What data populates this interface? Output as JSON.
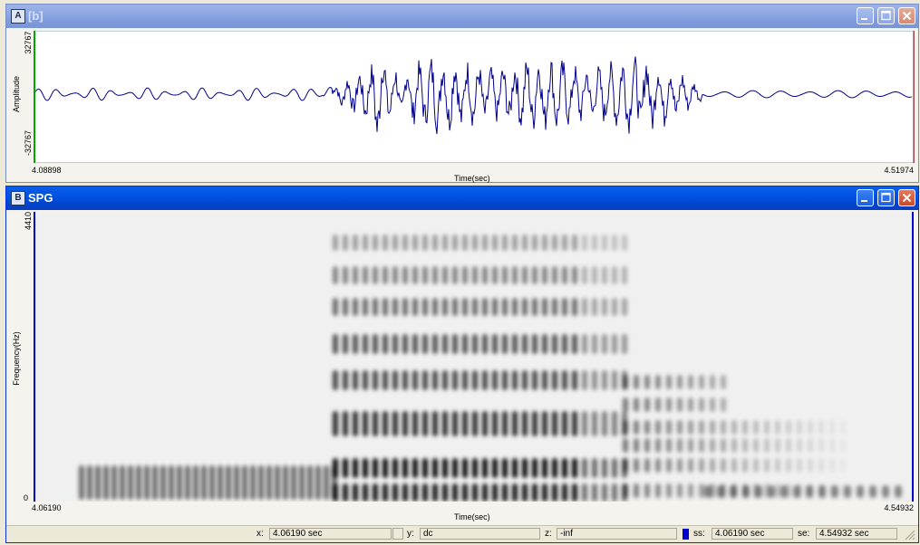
{
  "window_a": {
    "icon_letter": "A",
    "title": "[b]",
    "waveform": {
      "y_axis_label": "Amplitude",
      "y_max": "32767",
      "y_min": "-32767",
      "x_start": "4.08898",
      "x_end": "4.51974",
      "x_axis_label": "Time(sec)",
      "trace_color": "#00008b"
    }
  },
  "window_b": {
    "icon_letter": "B",
    "title": "SPG",
    "spectrogram": {
      "y_axis_label": "Frequency(Hz)",
      "y_max": "4410",
      "y_min": "0",
      "x_start": "4.06190",
      "x_end": "4.54932",
      "x_axis_label": "Time(sec)"
    }
  },
  "statusbar": {
    "x_label": "x:",
    "x_value": "4.06190 sec",
    "y_label": "y:",
    "y_value": "dc",
    "z_label": "z:",
    "z_value": "-inf",
    "ss_label": "ss:",
    "ss_value": "4.06190 sec",
    "se_label": "se:",
    "se_value": "4.54932 sec",
    "ss_swatch_color": "#0000cc"
  },
  "colors": {
    "active_titlebar": "#0052e0",
    "inactive_titlebar": "#8ea8e4",
    "cursor_green": "#00aa00",
    "cursor_blue": "#0000cc",
    "cursor_red": "#cc0000"
  }
}
